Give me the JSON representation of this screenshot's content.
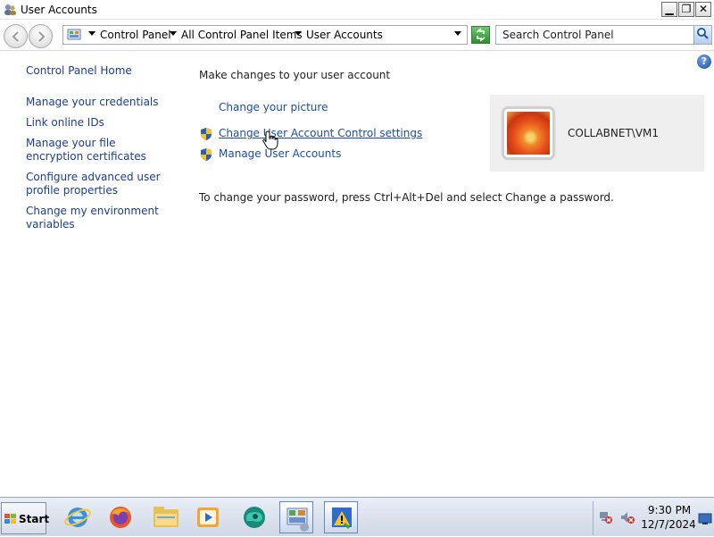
{
  "window": {
    "title": "User Accounts",
    "minimize_label": "▁",
    "maximize_label": "❐",
    "close_label": "✕"
  },
  "address": {
    "crumbs": [
      "Control Panel",
      "All Control Panel Items",
      "User Accounts"
    ]
  },
  "search": {
    "placeholder": "Search Control Panel"
  },
  "help_label": "?",
  "sidebar": {
    "items": [
      {
        "label": "Control Panel Home"
      },
      {
        "label": "Manage your credentials"
      },
      {
        "label": "Link online IDs"
      },
      {
        "label": "Manage your file encryption certificates"
      },
      {
        "label": "Configure advanced user profile properties"
      },
      {
        "label": "Change my environment variables"
      }
    ]
  },
  "main": {
    "heading": "Make changes to your user account",
    "tasks": [
      {
        "label": "Change your picture",
        "icon": "none"
      },
      {
        "label": "Change User Account Control settings",
        "icon": "uac-shield-icon"
      },
      {
        "label": "Manage User Accounts",
        "icon": "uac-shield-icon"
      }
    ],
    "password_note": "To change your password, press Ctrl+Alt+Del and select Change a password."
  },
  "user": {
    "name": "COLLABNET\\VM1"
  },
  "taskbar": {
    "start_label": "Start",
    "apps": [
      "internet-explorer-icon",
      "firefox-icon",
      "file-explorer-icon",
      "media-player-icon",
      "browser-icon",
      "control-panel-icon",
      "action-center-icon"
    ],
    "clock": {
      "time": "9:30 PM",
      "date": "12/7/2024"
    }
  },
  "colors": {
    "link": "#1c4ea0",
    "nav_link": "#1c3d8c",
    "user_panel": "#efefef"
  }
}
